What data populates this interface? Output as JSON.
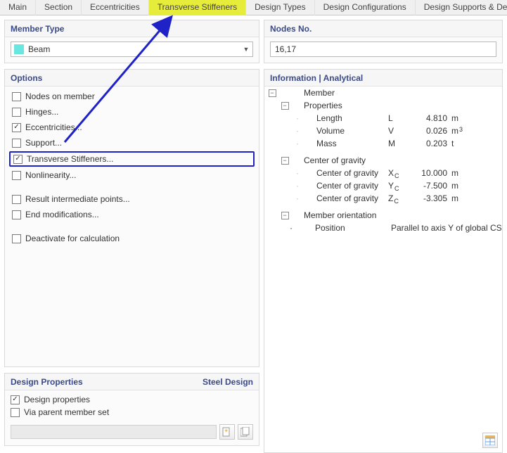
{
  "tabs": {
    "items": [
      {
        "label": "Main"
      },
      {
        "label": "Section"
      },
      {
        "label": "Eccentricities"
      },
      {
        "label": "Transverse Stiffeners",
        "highlight": true
      },
      {
        "label": "Design Types"
      },
      {
        "label": "Design Configurations"
      },
      {
        "label": "Design Supports & Deflection"
      }
    ]
  },
  "member_type": {
    "header": "Member Type",
    "value": "Beam"
  },
  "options": {
    "header": "Options",
    "items": [
      {
        "label": "Nodes on member",
        "checked": false
      },
      {
        "label": "Hinges...",
        "checked": false
      },
      {
        "label": "Eccentricities...",
        "checked": true
      },
      {
        "label": "Support...",
        "checked": false
      },
      {
        "label": "Transverse Stiffeners...",
        "checked": true,
        "highlighted": true
      },
      {
        "label": "Nonlinearity...",
        "checked": false
      },
      {
        "label": "Result intermediate points...",
        "checked": false
      },
      {
        "label": "End modifications...",
        "checked": false
      },
      {
        "label": "Deactivate for calculation",
        "checked": false
      }
    ]
  },
  "design_properties": {
    "header_left": "Design Properties",
    "header_right": "Steel Design",
    "rows": [
      {
        "label": "Design properties",
        "checked": true
      },
      {
        "label": "Via parent member set",
        "checked": false
      }
    ]
  },
  "nodes": {
    "header": "Nodes No.",
    "value": "16,17"
  },
  "info": {
    "header": "Information | Analytical",
    "member_label": "Member",
    "groups": {
      "properties": {
        "label": "Properties",
        "rows": [
          {
            "name": "Length",
            "symbol": "L",
            "value": "4.810",
            "unit": "m"
          },
          {
            "name": "Volume",
            "symbol": "V",
            "value": "0.026",
            "unit": "m",
            "unit_sup": "3"
          },
          {
            "name": "Mass",
            "symbol": "M",
            "value": "0.203",
            "unit": "t"
          }
        ]
      },
      "cog": {
        "label": "Center of gravity",
        "rows": [
          {
            "name": "Center of gravity",
            "symbol": "X",
            "symbol_sub": "C",
            "value": "10.000",
            "unit": "m"
          },
          {
            "name": "Center of gravity",
            "symbol": "Y",
            "symbol_sub": "C",
            "value": "-7.500",
            "unit": "m"
          },
          {
            "name": "Center of gravity",
            "symbol": "Z",
            "symbol_sub": "C",
            "value": "-3.305",
            "unit": "m"
          }
        ]
      },
      "orientation": {
        "label": "Member orientation",
        "position_label": "Position",
        "position_value": "Parallel to axis Y of global CS"
      }
    }
  }
}
